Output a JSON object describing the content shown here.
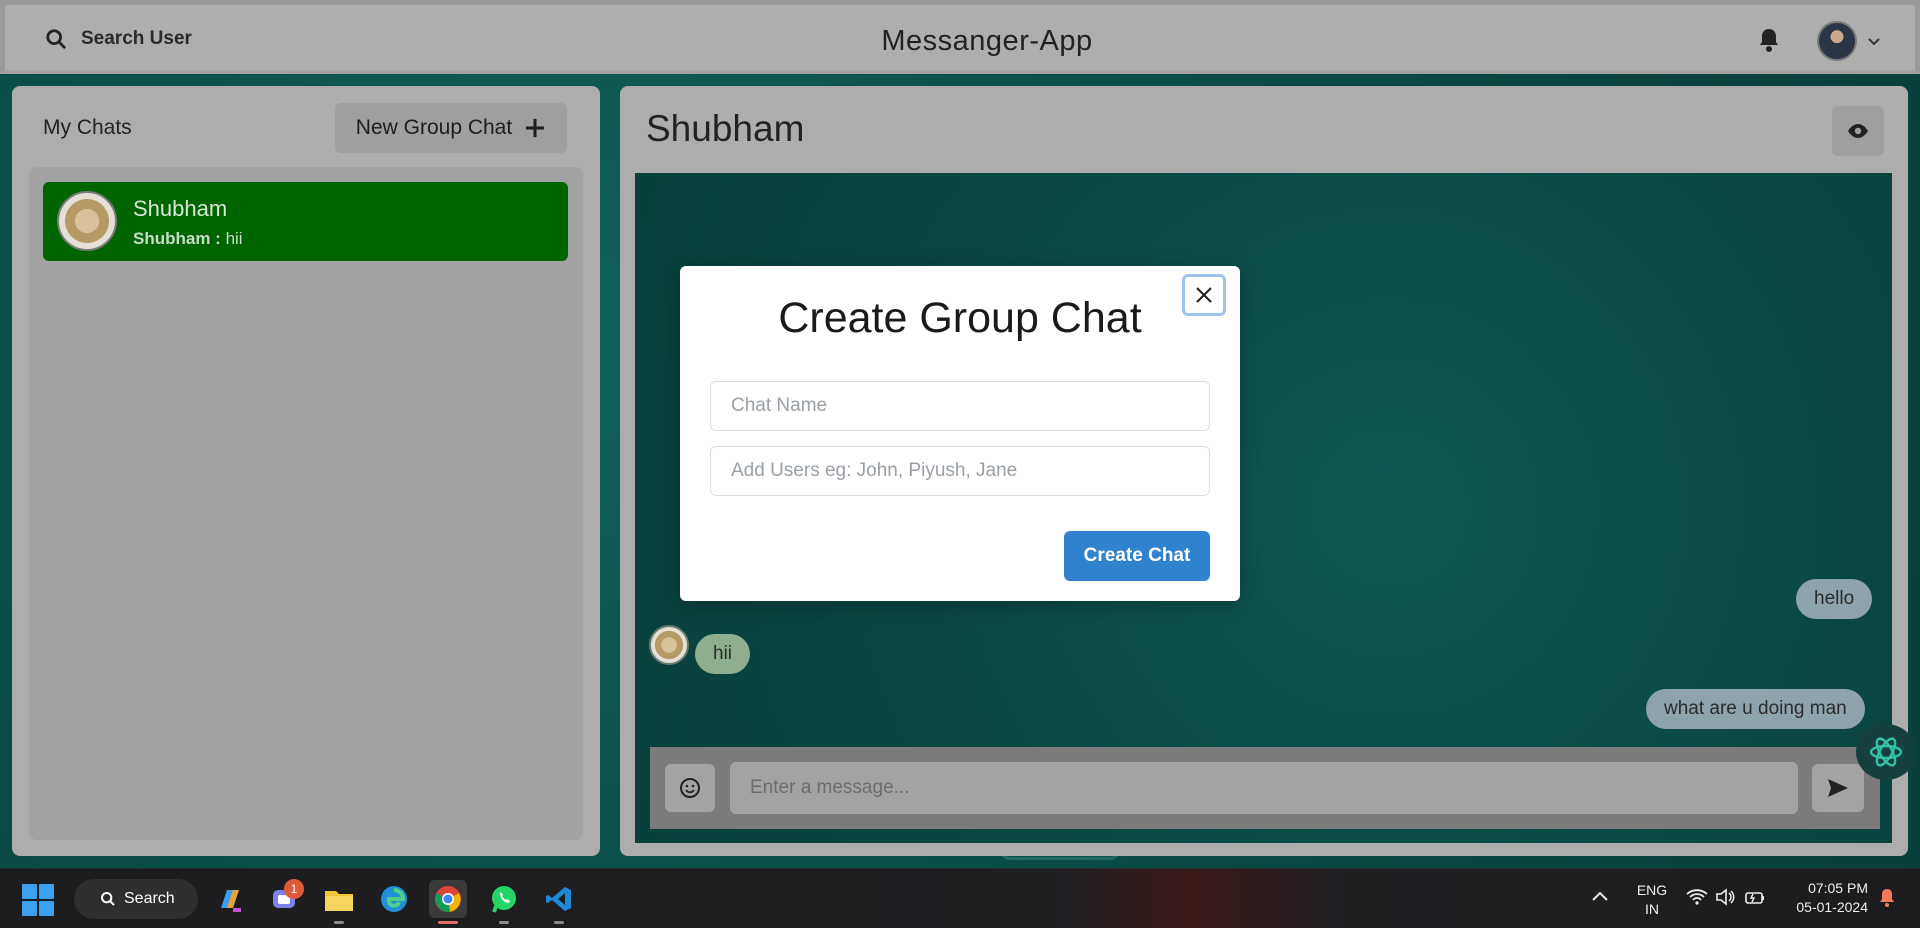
{
  "topbar": {
    "search_label": "Search User",
    "app_title": "Messanger-App"
  },
  "left": {
    "heading": "My Chats",
    "new_group_label": "New Group Chat",
    "chats": [
      {
        "name": "Shubham",
        "last_sender": "Shubham :",
        "last_message": "hii"
      }
    ]
  },
  "right": {
    "chat_title": "Shubham",
    "messages": [
      {
        "from": "me",
        "text": "hello"
      },
      {
        "from": "them",
        "text": "hii"
      },
      {
        "from": "me",
        "text": "what are u doing man"
      }
    ],
    "input_placeholder": "Enter a message..."
  },
  "modal": {
    "title": "Create Group Chat",
    "chat_name_placeholder": "Chat Name",
    "users_placeholder": "Add Users eg: John, Piyush, Jane",
    "submit_label": "Create Chat"
  },
  "taskbar": {
    "search_label": "Search",
    "teams_badge": "1",
    "lang_line1": "ENG",
    "lang_line2": "IN",
    "time": "07:05 PM",
    "date": "05-01-2024"
  },
  "colors": {
    "accent_button": "#3182ce",
    "active_chat": "#006400",
    "panel": "#adadad"
  }
}
